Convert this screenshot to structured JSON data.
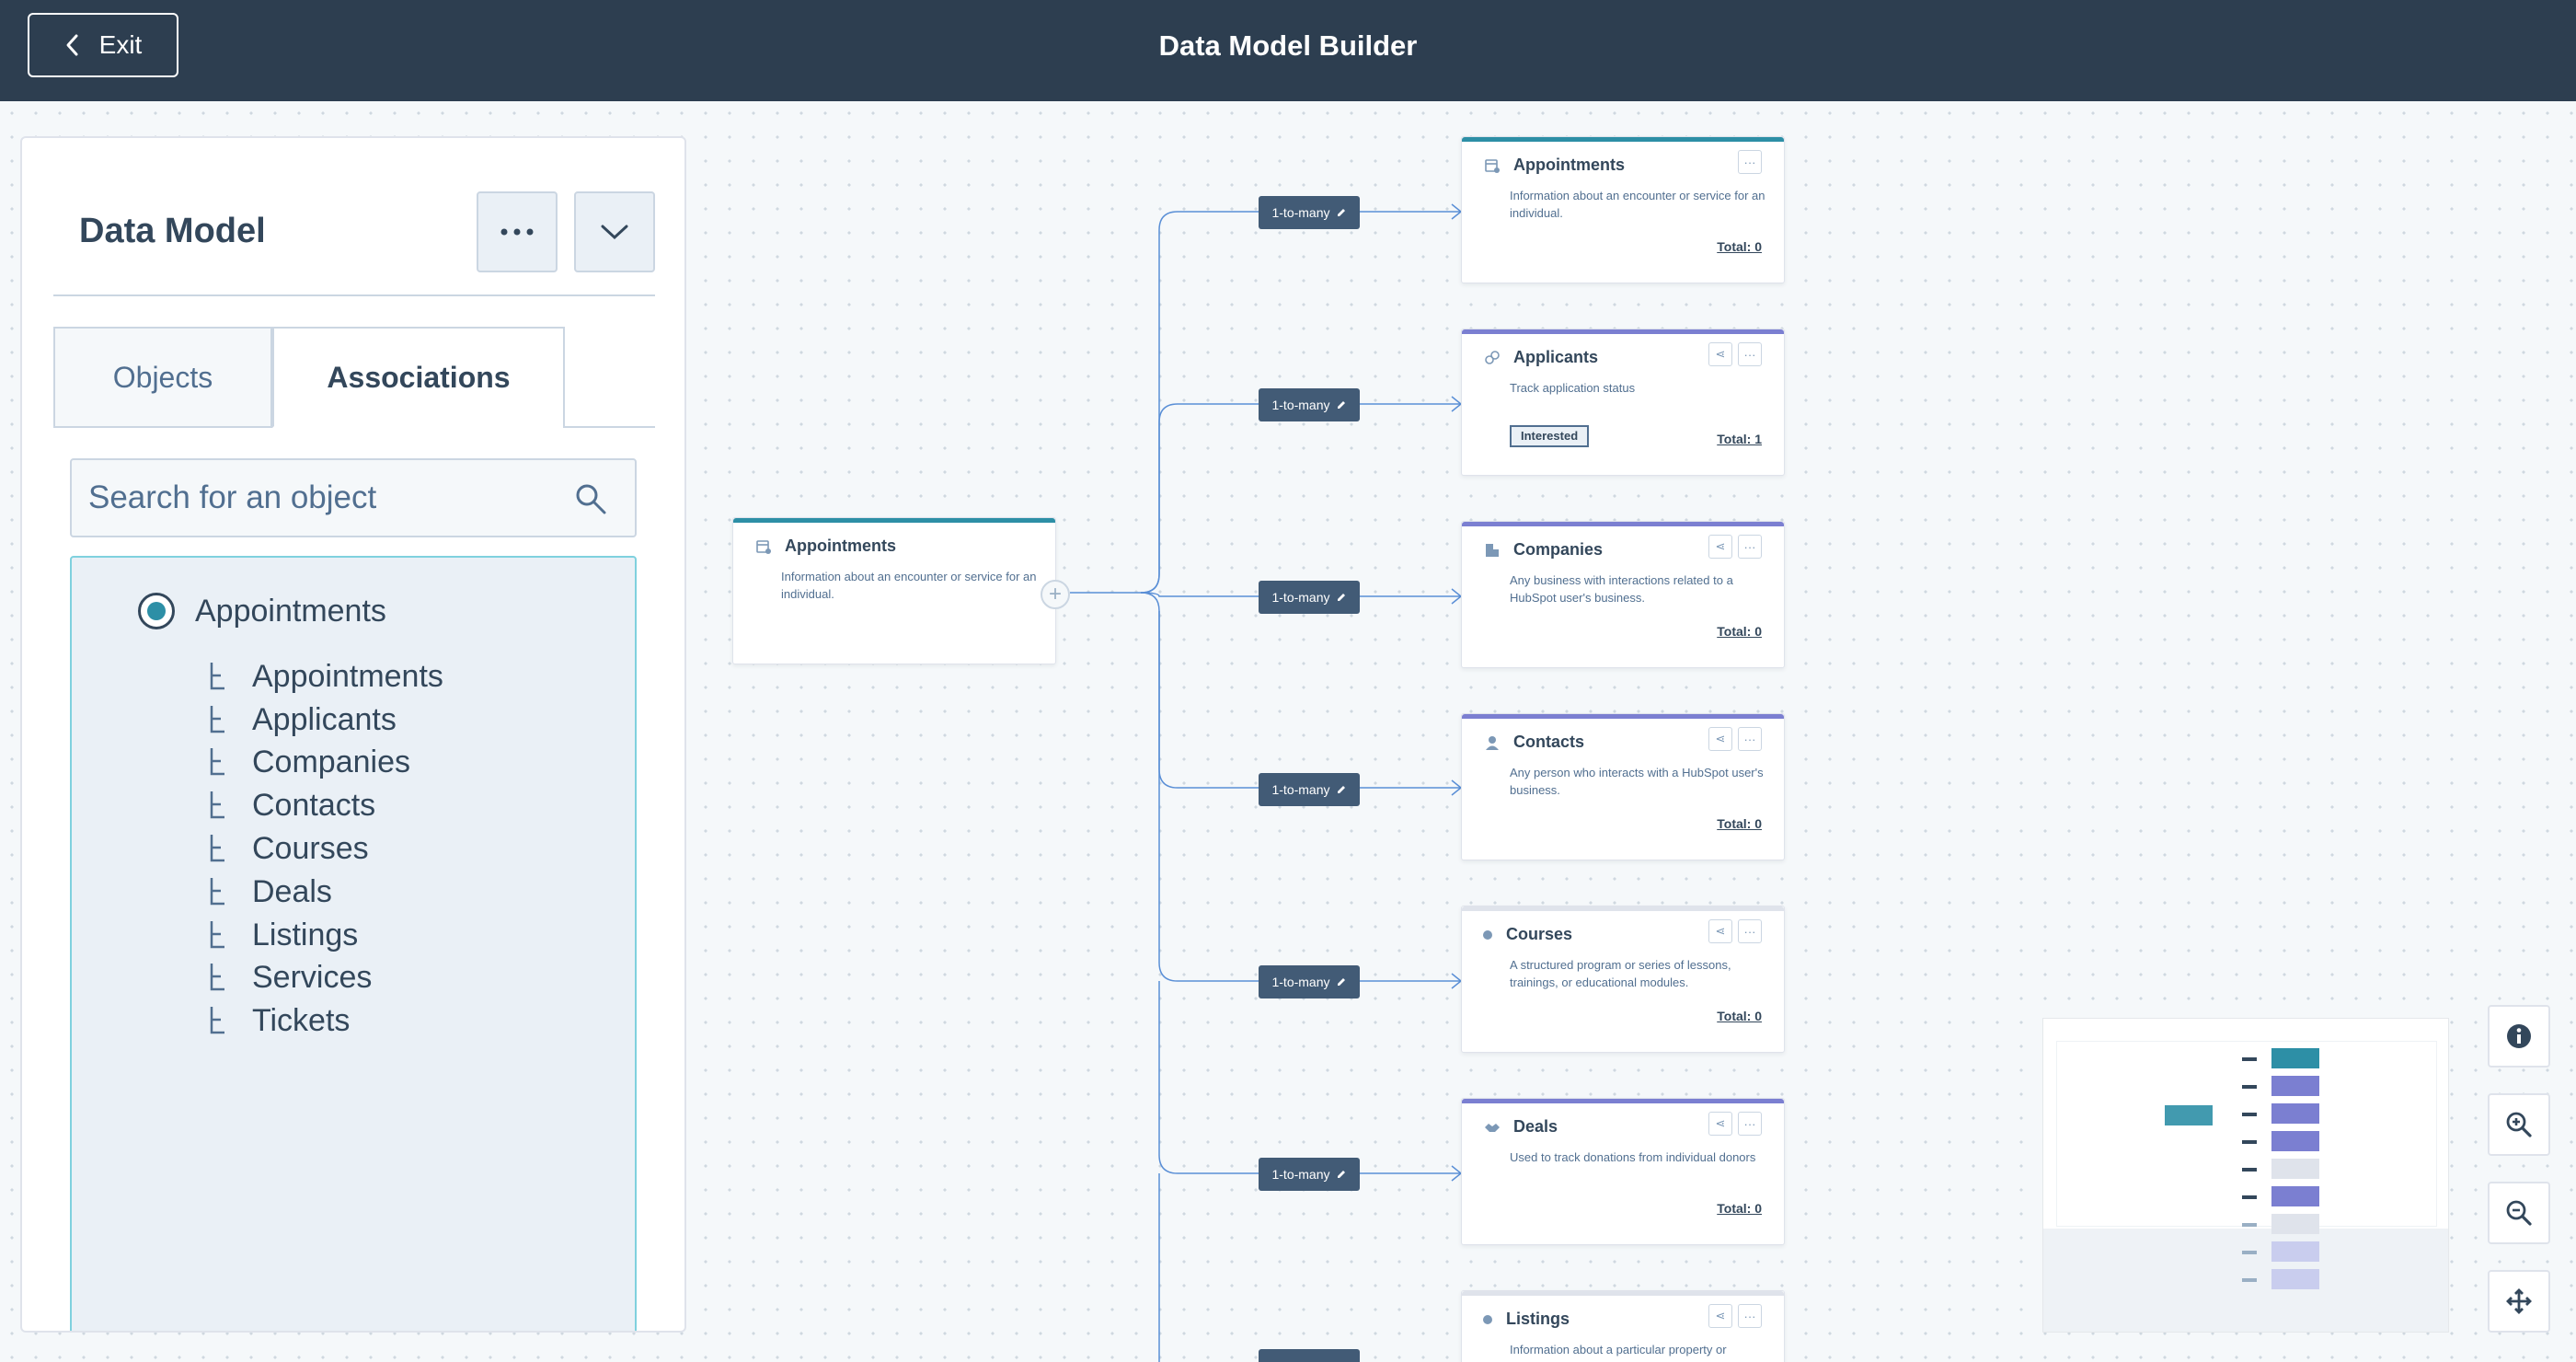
{
  "header": {
    "exit_label": "Exit",
    "title": "Data Model Builder"
  },
  "panel": {
    "title": "Data Model",
    "tabs": [
      {
        "label": "Objects"
      },
      {
        "label": "Associations"
      }
    ],
    "search_placeholder": "Search for an object",
    "selected_object": "Appointments",
    "associated_objects": [
      "Appointments",
      "Applicants",
      "Companies",
      "Contacts",
      "Courses",
      "Deals",
      "Listings",
      "Services",
      "Tickets"
    ]
  },
  "diagram": {
    "source": {
      "title": "Appointments",
      "description": "Information about an encounter or service for an individual."
    },
    "edge_label": "1-to-many",
    "targets": [
      {
        "title": "Appointments",
        "description": "Information about an encounter or service for an individual.",
        "total": "Total: 0",
        "color": "#2d8fa6"
      },
      {
        "title": "Applicants",
        "description": "Track application status",
        "tag": "Interested",
        "total": "Total: 1",
        "color": "#7b7fd1"
      },
      {
        "title": "Companies",
        "description": "Any business with interactions related to a HubSpot user's business.",
        "total": "Total: 0",
        "color": "#7b7fd1"
      },
      {
        "title": "Contacts",
        "description": "Any person who interacts with a HubSpot user's business.",
        "total": "Total: 0",
        "color": "#7b7fd1"
      },
      {
        "title": "Courses",
        "description": "A structured program or series of lessons, trainings, or educational modules.",
        "total": "Total: 0",
        "color": "#dfe3eb"
      },
      {
        "title": "Deals",
        "description": "Used to track donations from individual donors",
        "total": "Total: 0",
        "color": "#7b7fd1"
      },
      {
        "title": "Listings",
        "description": "Information about a particular property or",
        "total": "",
        "color": "#dfe3eb"
      }
    ]
  },
  "icons": {
    "exit": "chevron-left-icon",
    "more": "ellipsis-icon",
    "collapse": "chevron-down-icon",
    "search": "search-icon",
    "info": "info-icon",
    "zoom_in": "zoom-in-icon",
    "zoom_out": "zoom-out-icon",
    "pan": "move-icon"
  },
  "colors": {
    "header_bg": "#2d3e50",
    "accent": "#2d8fa6",
    "association_accent": "#7b7fd1",
    "edge": "#5a8fd6",
    "edge_label_bg": "#425b76"
  }
}
